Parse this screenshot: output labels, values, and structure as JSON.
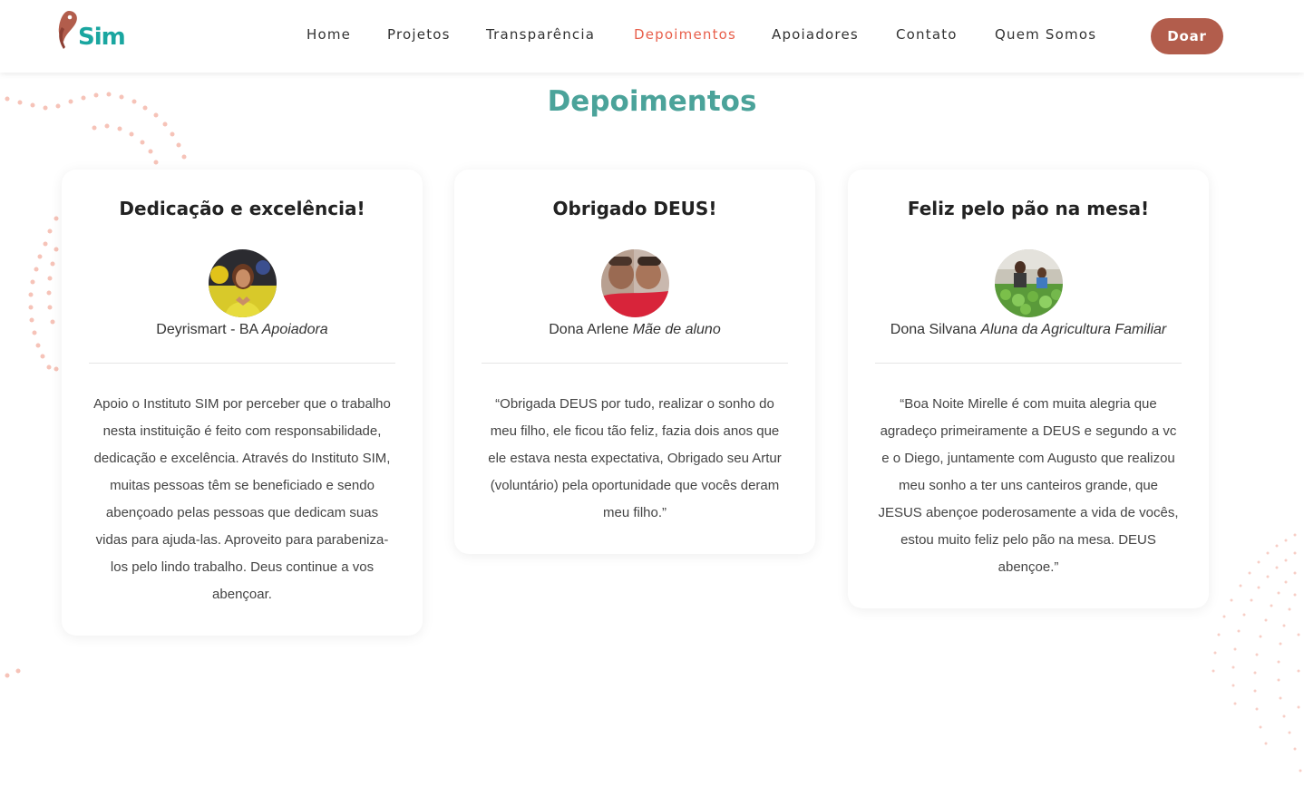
{
  "header": {
    "logo_text": "Sim",
    "nav": [
      {
        "label": "Home",
        "active": false
      },
      {
        "label": "Projetos",
        "active": false
      },
      {
        "label": "Transparência",
        "active": false
      },
      {
        "label": "Depoimentos",
        "active": true
      },
      {
        "label": "Apoiadores",
        "active": false
      },
      {
        "label": "Contato",
        "active": false
      },
      {
        "label": "Quem Somos",
        "active": false
      }
    ],
    "donate_label": "Doar"
  },
  "page_title": "Depoimentos",
  "testimonials": [
    {
      "title": "Dedicação e excelência!",
      "name": "Deyrismart - BA",
      "role": "Apoiadora",
      "quote": "Apoio o Instituto SIM por perceber que o trabalho nesta instituição é feito com responsabilidade, dedicação e excelência. Através do Instituto SIM, muitas pessoas têm se beneficiado e sendo abençoado pelas pessoas que dedicam suas vidas para ajuda-las. Aproveito para parabeniza-los pelo lindo trabalho. Deus continue a vos abençoar."
    },
    {
      "title": "Obrigado DEUS!",
      "name": "Dona Arlene",
      "role": "Mãe de aluno",
      "quote": "“Obrigada DEUS por tudo, realizar o sonho do meu filho, ele ficou tão feliz, fazia dois anos que ele estava nesta expectativa, Obrigado seu Artur (voluntário) pela oportunidade que vocês deram meu filho.”"
    },
    {
      "title": "Feliz pelo pão na mesa!",
      "name": "Dona Silvana",
      "role": "Aluna da Agricultura Familiar",
      "quote": "“Boa Noite Mirelle é com muita alegria que agradeço primeiramente a DEUS e segundo a vc e o Diego, juntamente com Augusto que realizou meu sonho a ter uns canteiros grande, que JESUS abençoe poderosamente a vida de vocês, estou muito feliz pelo pão na mesa. DEUS abençoe.”"
    }
  ],
  "colors": {
    "accent": "#e8604c",
    "title_teal": "#4ba39a",
    "button": "#b25d4c",
    "logo_teal": "#1aa6a0"
  }
}
